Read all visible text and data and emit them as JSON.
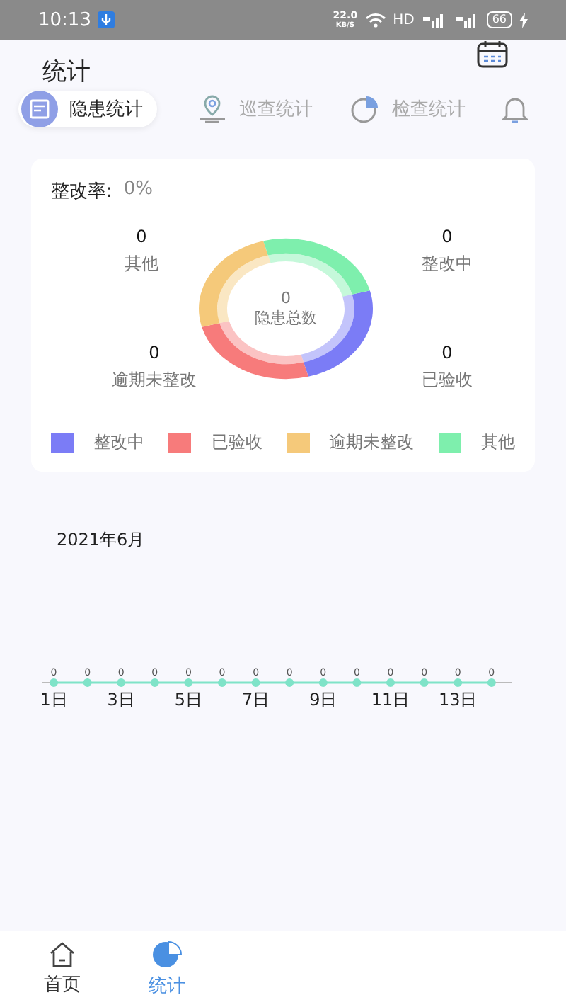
{
  "status_bar": {
    "time": "10:13",
    "speed": "22.0",
    "speed_unit": "KB/S",
    "network": "HD",
    "battery": "66"
  },
  "header": {
    "title": "统计"
  },
  "tabs": [
    {
      "label": "隐患统计",
      "selected": true
    },
    {
      "label": "巡查统计",
      "selected": false
    },
    {
      "label": "检查统计",
      "selected": false
    },
    {
      "selected": false
    }
  ],
  "summary": {
    "rate_label": "整改率:",
    "rate_value": "0%",
    "total_value": "0",
    "total_label": "隐患总数",
    "stats": [
      {
        "value": "0",
        "label": "其他"
      },
      {
        "value": "0",
        "label": "整改中"
      },
      {
        "value": "0",
        "label": "逾期未整改"
      },
      {
        "value": "0",
        "label": "已验收"
      }
    ],
    "legend": [
      {
        "label": "整改中",
        "color": "#7b7cf6"
      },
      {
        "label": "已验收",
        "color": "#f77b7b"
      },
      {
        "label": "逾期未整改",
        "color": "#f5c97a"
      },
      {
        "label": "其他",
        "color": "#7eefad"
      }
    ]
  },
  "trend": {
    "month": "2021年6月",
    "points": [
      {
        "value": "0",
        "day": "1日"
      },
      {
        "value": "0"
      },
      {
        "value": "0",
        "day": "3日"
      },
      {
        "value": "0"
      },
      {
        "value": "0",
        "day": "5日"
      },
      {
        "value": "0"
      },
      {
        "value": "0",
        "day": "7日"
      },
      {
        "value": "0"
      },
      {
        "value": "0",
        "day": "9日"
      },
      {
        "value": "0"
      },
      {
        "value": "0",
        "day": "11日"
      },
      {
        "value": "0"
      },
      {
        "value": "0",
        "day": "13日"
      },
      {
        "value": "0"
      }
    ]
  },
  "nav": [
    {
      "label": "首页",
      "selected": false
    },
    {
      "label": "统计",
      "selected": true
    }
  ]
}
